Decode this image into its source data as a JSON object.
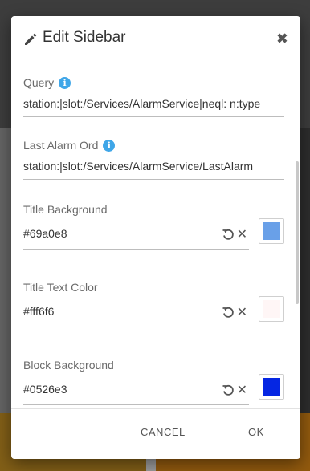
{
  "dialog": {
    "title": "Edit Sidebar",
    "close_symbol": "✖"
  },
  "fields": {
    "query": {
      "label": "Query",
      "info_symbol": "i",
      "value": "station:|slot:/Services/AlarmService|neql: n:type"
    },
    "last_alarm_ord": {
      "label": "Last Alarm Ord",
      "info_symbol": "i",
      "value": "station:|slot:/Services/AlarmService/LastAlarm"
    },
    "title_background": {
      "label": "Title Background",
      "value": "#69a0e8",
      "swatch_color": "#69a0e8",
      "clear_symbol": "✕"
    },
    "title_text_color": {
      "label": "Title Text Color",
      "value": "#fff6f6",
      "swatch_color": "#fff6f6",
      "clear_symbol": "✕"
    },
    "block_background": {
      "label": "Block Background",
      "value": "#0526e3",
      "swatch_color": "#0526e3",
      "clear_symbol": "✕"
    }
  },
  "footer": {
    "cancel_label": "CANCEL",
    "ok_label": "OK"
  },
  "icons": {
    "header": "pencil-icon",
    "info": "info-icon",
    "reset": "reset-icon",
    "clear": "clear-icon"
  }
}
